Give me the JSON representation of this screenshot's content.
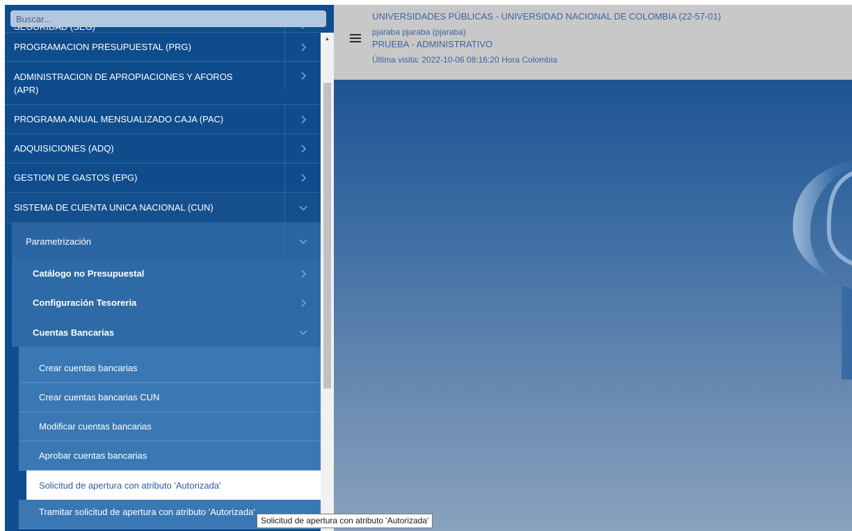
{
  "search": {
    "placeholder": "Buscar..."
  },
  "menu": {
    "modules": [
      {
        "label": "SEGURIDAD (SEG)"
      },
      {
        "label": "PROGRAMACION PRESUPUESTAL (PRG)"
      },
      {
        "label": "ADMINISTRACION DE APROPIACIONES Y AFOROS (APR)"
      },
      {
        "label": "PROGRAMA ANUAL MENSUALIZADO CAJA (PAC)"
      },
      {
        "label": "ADQUISICIONES (ADQ)"
      },
      {
        "label": "GESTION DE GASTOS (EPG)"
      },
      {
        "label": "SISTEMA DE CUENTA UNICA NACIONAL (CUN)"
      }
    ],
    "submenu": {
      "label": "Parametrización"
    },
    "sections": [
      {
        "label": "Catálogo no Presupuestal"
      },
      {
        "label": "Configuración Tesoreria"
      },
      {
        "label": "Cuentas Bancarias"
      }
    ],
    "items": [
      {
        "label": "Crear cuentas bancarias"
      },
      {
        "label": "Crear cuentas bancarias CUN"
      },
      {
        "label": "Modificar cuentas bancarias"
      },
      {
        "label": "Aprobar cuentas bancarias"
      },
      {
        "label": "Solicitud de apertura con atributo 'Autorizada'"
      },
      {
        "label": "Tramitar solicitud de apertura con atributo 'Autorizada'"
      }
    ]
  },
  "header": {
    "title": "UNIVERSIDADES PÚBLICAS - UNIVERSIDAD NACIONAL DE COLOMBIA (22-57-01)",
    "user": "pjaraba pjaraba (pjaraba)",
    "role": "PRUEBA - ADMINISTRATIVO",
    "last_visit": "Última visita: 2022-10-06 08:16:20 Hora Colombia"
  },
  "tooltip": {
    "text": "Solicitud  de apertura con atributo 'Autorizada'"
  },
  "colors": {
    "sidebar": "#0f4d8f",
    "header": "#c8c8c8",
    "header_text": "#3e63a0",
    "selected_text": "#2b5f9e"
  }
}
